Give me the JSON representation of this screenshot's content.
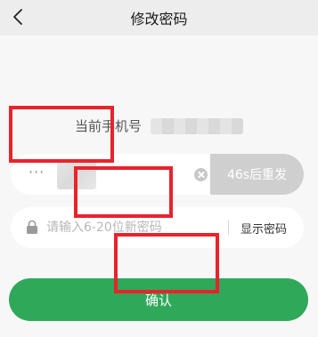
{
  "nav": {
    "back_icon": "chevron-left-icon",
    "title": "修改密码"
  },
  "phone": {
    "label": "当前手机号",
    "value_masked": true
  },
  "code": {
    "value": "···",
    "value_obscured": true,
    "clear_icon": "clear-circle-icon",
    "resend_label": "46s后重发"
  },
  "password": {
    "lock_icon": "lock-icon",
    "placeholder": "请输入6-20位新密码",
    "show_label": "显示密码"
  },
  "confirm_label": "确认",
  "colors": {
    "primary": "#2fa85a",
    "resend_bg": "#cfcfcf",
    "annotation": "#e8232b",
    "page_bg": "#f7f7f7",
    "nav_bg": "#ededed"
  }
}
